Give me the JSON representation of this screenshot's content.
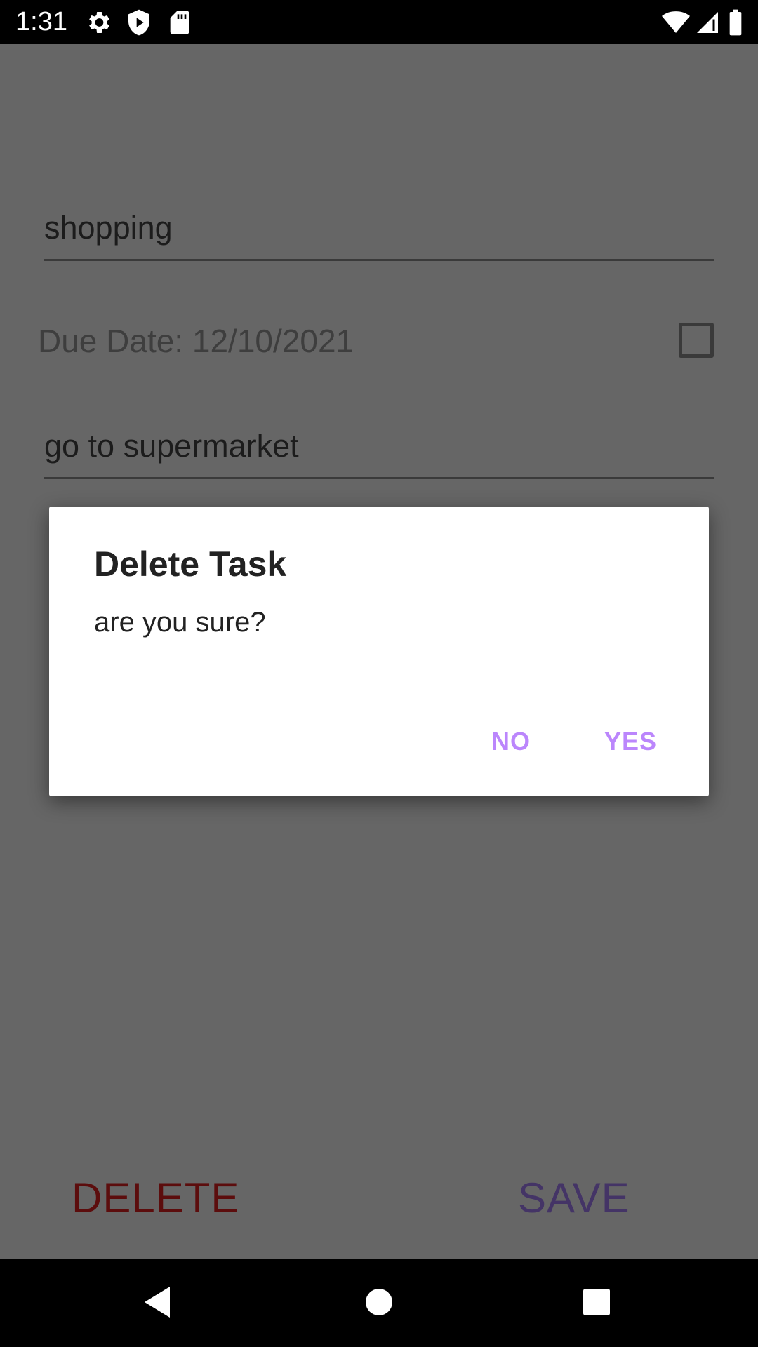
{
  "status_bar": {
    "time": "1:31",
    "left_icons": [
      "gear-icon",
      "shield-play-icon",
      "sd-card-icon"
    ],
    "right_icons": [
      "wifi-icon",
      "signal-icon",
      "battery-icon"
    ]
  },
  "form": {
    "title_value": "shopping",
    "due_date_label": "Due Date: 12/10/2021",
    "completed_checked": false,
    "notes_value": "go to supermarket"
  },
  "actions": {
    "delete_label": "DELETE",
    "save_label": "SAVE"
  },
  "dialog": {
    "title": "Delete Task",
    "message": "are you sure?",
    "no_label": "NO",
    "yes_label": "YES",
    "button_color": "#bb86fc"
  },
  "nav_bar": {
    "icons": [
      "back-icon",
      "home-icon",
      "recents-icon"
    ]
  },
  "colors": {
    "scrim": "#666666",
    "delete": "#5c0d0d",
    "save": "#443466"
  }
}
